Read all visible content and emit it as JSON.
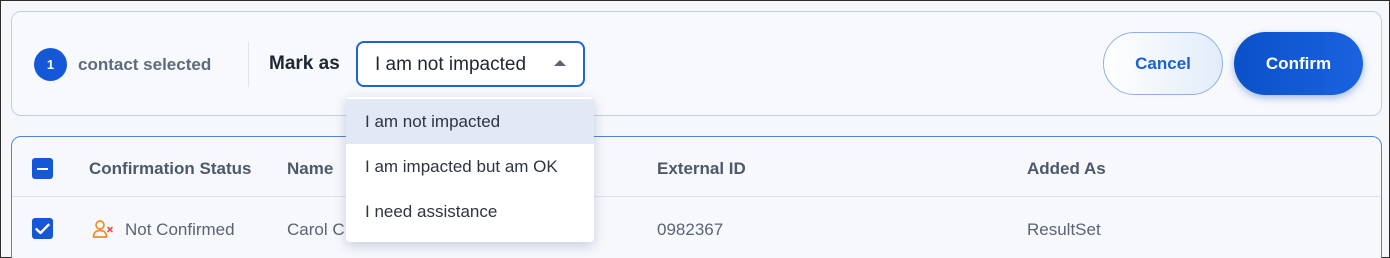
{
  "selection": {
    "count": "1",
    "label": "contact selected"
  },
  "mark_as": {
    "label": "Mark as",
    "selected": "I am not impacted",
    "options": [
      "I am not impacted",
      "I am impacted but am OK",
      "I need assistance"
    ]
  },
  "buttons": {
    "cancel": "Cancel",
    "confirm": "Confirm"
  },
  "table": {
    "columns": [
      "Confirmation Status",
      "Name",
      "External ID",
      "Added As"
    ],
    "rows": [
      {
        "checked": true,
        "status": "Not Confirmed",
        "name": "Carol C",
        "external_id": "0982367",
        "added_as": "ResultSet"
      }
    ]
  },
  "colors": {
    "accent": "#1458d8",
    "status_warning": "#f08a24"
  }
}
